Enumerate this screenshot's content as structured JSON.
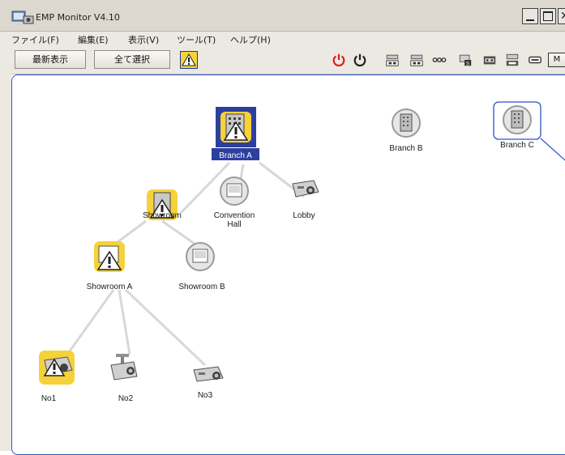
{
  "window": {
    "title": "EMP Monitor V4.10",
    "controls": [
      "_",
      "□",
      "X"
    ]
  },
  "menu": {
    "items": [
      "ファイル(F)",
      "編集(E)",
      "表示(V)",
      "ツール(T)",
      "ヘルプ(H)"
    ]
  },
  "toolbar": {
    "refresh_label": "最新表示",
    "select_all_label": "全て選択",
    "m_label": "M"
  },
  "tree": {
    "nodes": [
      {
        "id": "branch-a",
        "label": "Branch A",
        "icon": "building-icon",
        "status": "warning",
        "selected": true
      },
      {
        "id": "branch-b",
        "label": "Branch B",
        "icon": "building-icon",
        "status": "normal"
      },
      {
        "id": "branch-c",
        "label": "Branch C",
        "icon": "building-icon",
        "status": "normal",
        "focused": true
      },
      {
        "id": "showroom",
        "label": "Showroom",
        "icon": "building-icon",
        "status": "warning"
      },
      {
        "id": "convention-hall",
        "label": "Convention\nHall",
        "icon": "room-icon",
        "status": "normal"
      },
      {
        "id": "lobby",
        "label": "Lobby",
        "icon": "projector-icon",
        "status": "normal"
      },
      {
        "id": "showroom-a",
        "label": "Showroom A",
        "icon": "room-icon",
        "status": "warning"
      },
      {
        "id": "showroom-b",
        "label": "Showroom B",
        "icon": "room-icon",
        "status": "normal"
      },
      {
        "id": "no1",
        "label": "No1",
        "icon": "projector-icon",
        "status": "warning"
      },
      {
        "id": "no2",
        "label": "No2",
        "icon": "projector-icon",
        "status": "normal"
      },
      {
        "id": "no3",
        "label": "No3",
        "icon": "projector-icon",
        "status": "normal"
      }
    ]
  },
  "colors": {
    "warning_bg": "#f6d23a",
    "selection_bg": "#2d3f9e",
    "focus_border": "#2b55c8",
    "power_on": "#d42020"
  }
}
